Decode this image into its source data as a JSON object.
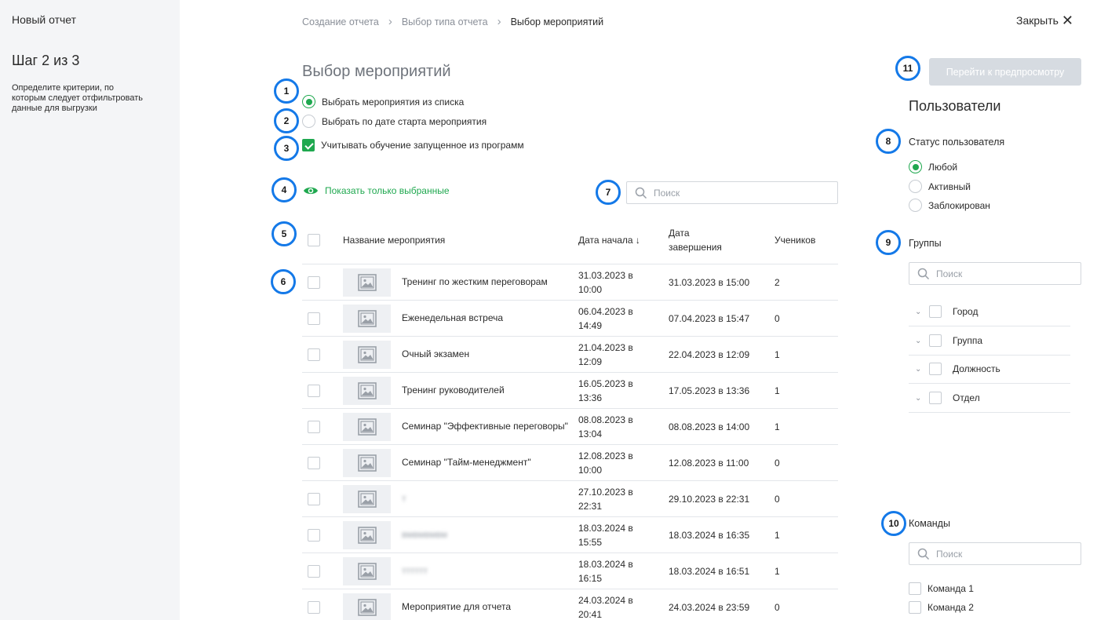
{
  "sidebar": {
    "app_title": "Новый отчет",
    "step": "Шаг 2 из 3",
    "hint": "Определите критерии, по которым следует отфильтровать данные для выгрузки"
  },
  "breadcrumb": [
    "Создание отчета",
    "Выбор типа отчета",
    "Выбор мероприятий"
  ],
  "close_label": "Закрыть",
  "page_title": "Выбор мероприятий",
  "options": {
    "from_list": "Выбрать мероприятия из списка",
    "by_date": "Выбрать по дате старта мероприятия",
    "include_programs": "Учитывать обучение запущенное из программ",
    "selected_mode": "from_list",
    "include_programs_checked": true
  },
  "show_selected_label": "Показать только выбранные",
  "search_placeholder": "Поиск",
  "table": {
    "headers": {
      "name": "Название мероприятия",
      "start": "Дата начала",
      "end": "Дата завершения",
      "count": "Учеников"
    },
    "rows": [
      {
        "name": "Тренинг по жестким переговорам",
        "start": "31.03.2023 в 10:00",
        "end": "31.03.2023 в 15:00",
        "count": "2"
      },
      {
        "name": "Еженедельная встреча",
        "start": "06.04.2023 в 14:49",
        "end": "07.04.2023 в 15:47",
        "count": "0"
      },
      {
        "name": "Очный экзамен",
        "start": "21.04.2023 в 12:09",
        "end": "22.04.2023 в 12:09",
        "count": "1"
      },
      {
        "name": "Тренинг руководителей",
        "start": "16.05.2023 в 13:36",
        "end": "17.05.2023 в 13:36",
        "count": "1"
      },
      {
        "name": "Семинар \"Эффективные переговоры\"",
        "start": "08.08.2023 в 13:04",
        "end": "08.08.2023 в 14:00",
        "count": "1"
      },
      {
        "name": "Семинар \"Тайм-менеджмент\"",
        "start": "12.08.2023 в 10:00",
        "end": "12.08.2023 в 11:00",
        "count": "0"
      },
      {
        "name": "т",
        "start": "27.10.2023 в 22:31",
        "end": "29.10.2023 в 22:31",
        "count": "0"
      },
      {
        "name": "вмвмвмвм",
        "start": "18.03.2024 в 15:55",
        "end": "18.03.2024 в 16:35",
        "count": "1"
      },
      {
        "name": "тттттт",
        "start": "18.03.2024 в 16:15",
        "end": "18.03.2024 в 16:51",
        "count": "1"
      },
      {
        "name": "Мероприятие для отчета",
        "start": "24.03.2024 в 20:41",
        "end": "24.03.2024 в 23:59",
        "count": "0"
      }
    ]
  },
  "preview_button": "Перейти к предпросмотру",
  "users": {
    "title": "Пользователи",
    "status_title": "Статус пользователя",
    "statuses": [
      "Любой",
      "Активный",
      "Заблокирован"
    ],
    "groups_title": "Группы",
    "groups": [
      "Город",
      "Группа",
      "Должность",
      "Отдел"
    ],
    "teams_title": "Команды",
    "teams": [
      "Команда 1",
      "Команда 2"
    ]
  },
  "badges": [
    "1",
    "2",
    "3",
    "4",
    "5",
    "6",
    "7",
    "8",
    "9",
    "10",
    "11"
  ],
  "colors": {
    "accent_green": "#1fa84f",
    "badge_blue": "#1479e8",
    "sidebar_bg": "#f4f5f7",
    "disabled_button": "#d6dbe1"
  }
}
